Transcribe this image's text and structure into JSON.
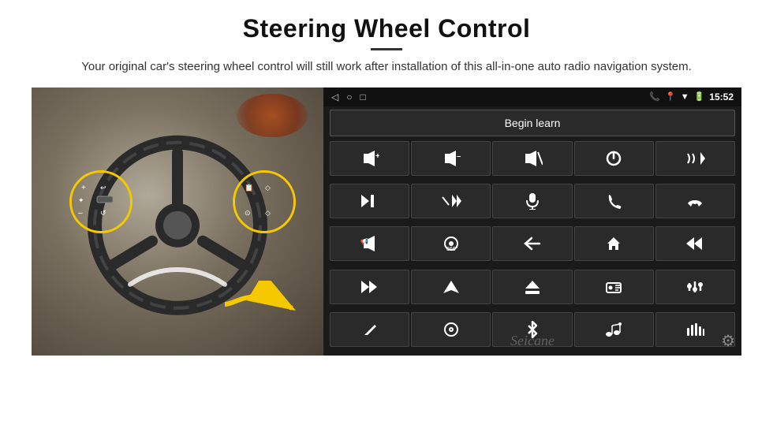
{
  "header": {
    "title": "Steering Wheel Control",
    "subtitle": "Your original car's steering wheel control will still work after installation of this all-in-one auto radio navigation system."
  },
  "screen": {
    "time": "15:52",
    "begin_learn": "Begin learn",
    "seicane": "Seicane",
    "nav_icons": [
      "◁",
      "○",
      "□"
    ],
    "status_icons": [
      "📞",
      "📍",
      "▼"
    ]
  },
  "controls": [
    {
      "icon": "🔊+",
      "unicode": "▶+"
    },
    {
      "icon": "🔊-",
      "unicode": "◀-"
    },
    {
      "icon": "🔇",
      "unicode": "×"
    },
    {
      "icon": "⏻"
    },
    {
      "icon": "📞⏮"
    },
    {
      "icon": "⏭"
    },
    {
      "icon": "⏮⏩"
    },
    {
      "icon": "🎤"
    },
    {
      "icon": "📞"
    },
    {
      "icon": "↩"
    },
    {
      "icon": "📢"
    },
    {
      "icon": "360"
    },
    {
      "icon": "↩"
    },
    {
      "icon": "🏠"
    },
    {
      "icon": "⏮⏮"
    },
    {
      "icon": "⏭⏭"
    },
    {
      "icon": "▶"
    },
    {
      "icon": "⏏"
    },
    {
      "icon": "📻"
    },
    {
      "icon": "⚙"
    },
    {
      "icon": "🎤"
    },
    {
      "icon": "⚙"
    },
    {
      "icon": "✱"
    },
    {
      "icon": "♪"
    },
    {
      "icon": "📊"
    }
  ],
  "controls_text": [
    "vol+",
    "vol-",
    "mute",
    "power",
    "call_prev",
    "next",
    "shuffle_next",
    "mic",
    "call",
    "hang_up",
    "speaker",
    "360_cam",
    "back",
    "home",
    "prev_prev",
    "next_next",
    "navigate",
    "eject",
    "radio",
    "settings",
    "pen",
    "circle_menu",
    "bluetooth",
    "music_settings",
    "equalizer"
  ]
}
